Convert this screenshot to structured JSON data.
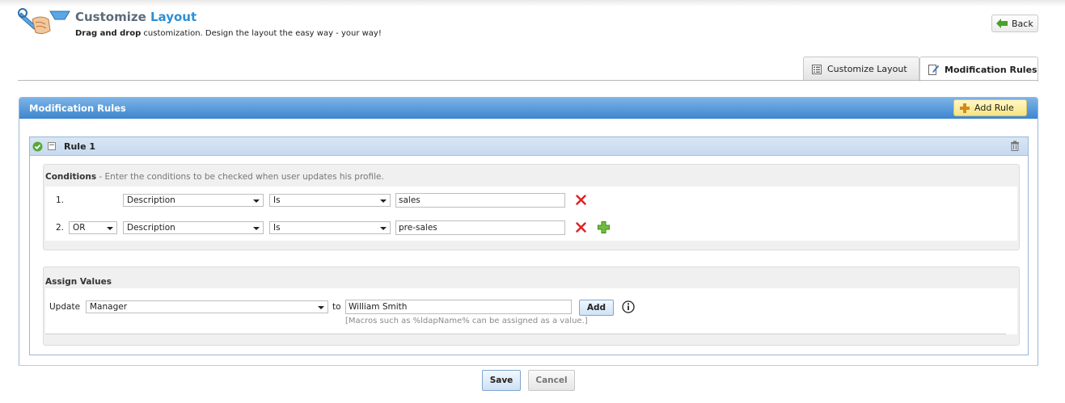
{
  "header": {
    "title_main": "Customize ",
    "title_accent": "Layout",
    "subtitle_bold": "Drag and drop",
    "subtitle_rest": " customization. Design the layout the easy way - your way!",
    "back_label": "Back"
  },
  "tabs": [
    {
      "label": "Customize Layout",
      "icon": "layout-list-icon",
      "active": false
    },
    {
      "label": "Modification Rules",
      "icon": "edit-document-icon",
      "active": true
    }
  ],
  "panel": {
    "title": "Modification Rules",
    "add_rule_label": "Add Rule"
  },
  "rule": {
    "title": "Rule 1",
    "status_icon": "check-circle-icon",
    "conditions_label": "Conditions",
    "conditions_hint": " - Enter the conditions to be checked when user updates his profile.",
    "conditions": [
      {
        "num": "1.",
        "join": "",
        "field": "Description",
        "operator": "Is",
        "value": "sales",
        "show_add": false
      },
      {
        "num": "2.",
        "join": "OR",
        "field": "Description",
        "operator": "Is",
        "value": "pre-sales",
        "show_add": true
      }
    ],
    "assign_label": "Assign Values",
    "assign": {
      "update_label": "Update",
      "field": "Manager",
      "to_label": "to",
      "value": "William Smith",
      "add_label": "Add",
      "macro_hint": "[Macros such as %ldapName% can be assigned as a value.]"
    }
  },
  "footer": {
    "save_label": "Save",
    "cancel_label": "Cancel"
  },
  "colors": {
    "accent": "#2b8fd6",
    "panel_header": "#3c86cf",
    "remove": "#e02020",
    "add": "#4aa02c"
  }
}
